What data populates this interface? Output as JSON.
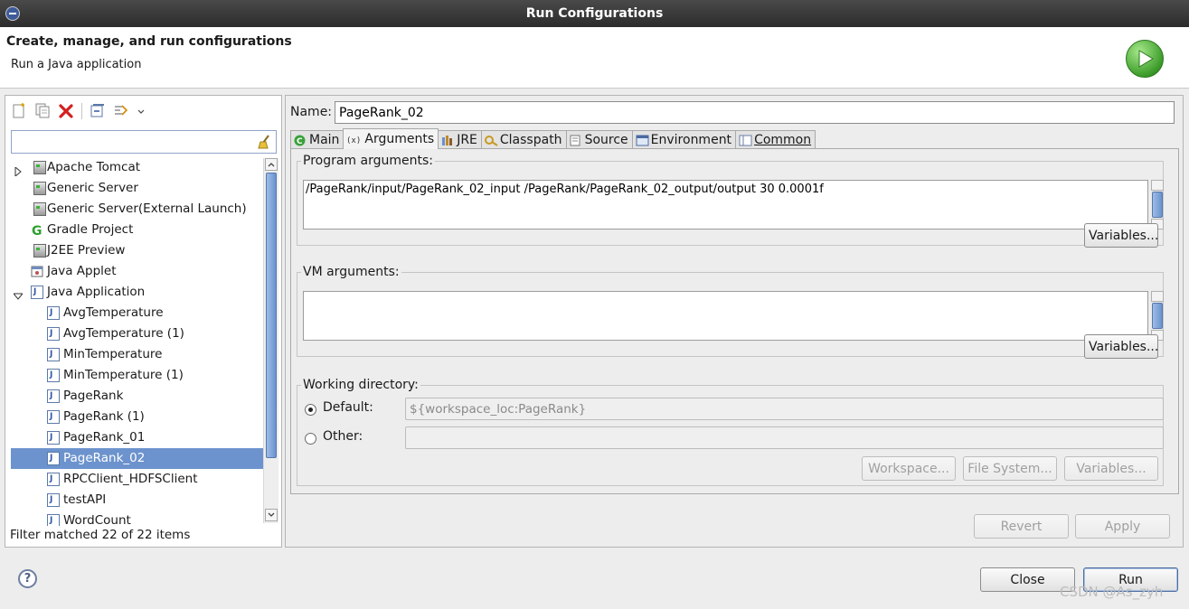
{
  "window": {
    "title": "Run Configurations"
  },
  "header": {
    "title": "Create, manage, and run configurations",
    "subtitle": "Run a Java application"
  },
  "left": {
    "filter": {
      "value": "",
      "placeholder": ""
    },
    "tree": [
      {
        "label": "Apache Tomcat",
        "icon": "server-icon",
        "level": 0,
        "twisty": "collapsed"
      },
      {
        "label": "Generic Server",
        "icon": "server-icon",
        "level": 0
      },
      {
        "label": "Generic Server(External Launch)",
        "icon": "server-icon",
        "level": 0
      },
      {
        "label": "Gradle Project",
        "icon": "gradle-icon",
        "level": 0
      },
      {
        "label": "J2EE Preview",
        "icon": "server-icon",
        "level": 0
      },
      {
        "label": "Java Applet",
        "icon": "applet-icon",
        "level": 0
      },
      {
        "label": "Java Application",
        "icon": "java-app-icon",
        "level": 0,
        "twisty": "expanded"
      },
      {
        "label": "AvgTemperature",
        "icon": "java-app-icon",
        "level": 1
      },
      {
        "label": "AvgTemperature (1)",
        "icon": "java-app-icon",
        "level": 1
      },
      {
        "label": "MinTemperature",
        "icon": "java-app-icon",
        "level": 1
      },
      {
        "label": "MinTemperature (1)",
        "icon": "java-app-icon",
        "level": 1
      },
      {
        "label": "PageRank",
        "icon": "java-app-icon",
        "level": 1
      },
      {
        "label": "PageRank (1)",
        "icon": "java-app-icon",
        "level": 1
      },
      {
        "label": "PageRank_01",
        "icon": "java-app-icon",
        "level": 1
      },
      {
        "label": "PageRank_02",
        "icon": "java-app-icon",
        "level": 1,
        "selected": true
      },
      {
        "label": "RPCClient_HDFSClient",
        "icon": "java-app-icon",
        "level": 1
      },
      {
        "label": "testAPI",
        "icon": "java-app-icon",
        "level": 1
      },
      {
        "label": "WordCount",
        "icon": "java-app-icon",
        "level": 1
      }
    ],
    "status": "Filter matched 22 of 22 items"
  },
  "right": {
    "name_label": "Name:",
    "name_value": "PageRank_02",
    "tabs": [
      {
        "label": "Main",
        "icon": "main-tab-icon"
      },
      {
        "label": "Arguments",
        "icon": "arguments-tab-icon",
        "active": true
      },
      {
        "label": "JRE",
        "icon": "jre-tab-icon"
      },
      {
        "label": "Classpath",
        "icon": "classpath-tab-icon"
      },
      {
        "label": "Source",
        "icon": "source-tab-icon"
      },
      {
        "label": "Environment",
        "icon": "environment-tab-icon"
      },
      {
        "label": "Common",
        "icon": "common-tab-icon"
      }
    ],
    "program_args": {
      "title": "Program arguments:",
      "value": "/PageRank/input/PageRank_02_input /PageRank/PageRank_02_output/output 30 0.0001f",
      "variables_label": "Variables..."
    },
    "vm_args": {
      "title": "VM arguments:",
      "value": "",
      "variables_label": "Variables..."
    },
    "working_dir": {
      "title": "Working directory:",
      "default_label": "Default:",
      "default_value": "${workspace_loc:PageRank}",
      "other_label": "Other:",
      "other_value": "",
      "workspace_label": "Workspace...",
      "filesystem_label": "File System...",
      "variables_label": "Variables..."
    },
    "revert_label": "Revert",
    "apply_label": "Apply"
  },
  "footer": {
    "help_label": "?",
    "close_label": "Close",
    "run_label": "Run"
  },
  "watermark": "CSDN @As_zyh",
  "colors": {
    "selection": "#6c93cd",
    "title_bar": "#2c2c2c",
    "run_logo": "#3c9c2a"
  }
}
